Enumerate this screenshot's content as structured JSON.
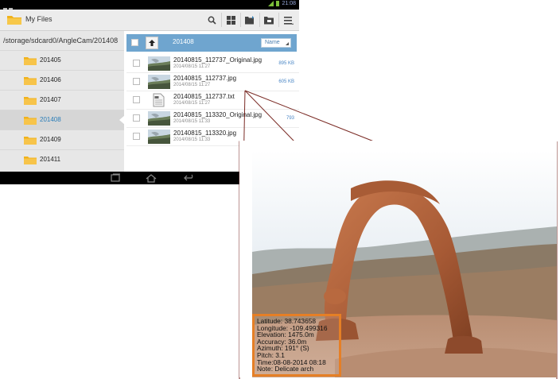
{
  "app": {
    "title": "My Files"
  },
  "actions": [
    "search-icon",
    "grid-view-icon",
    "new-folder-icon",
    "view-mode-icon",
    "more-menu-icon"
  ],
  "path": "/storage/sdcard0/AngleCam/201408",
  "folders": [
    {
      "name": "201405",
      "selected": false
    },
    {
      "name": "201406",
      "selected": false
    },
    {
      "name": "201407",
      "selected": false
    },
    {
      "name": "201408",
      "selected": true
    },
    {
      "name": "201409",
      "selected": false
    },
    {
      "name": "201411",
      "selected": false
    }
  ],
  "list_header": {
    "current_folder": "201408",
    "sort_label": "Name"
  },
  "files": [
    {
      "name": "20140815_112737_Original.jpg",
      "date": "2014/08/15 11:27",
      "size": "895 KB",
      "type": "image"
    },
    {
      "name": "20140815_112737.jpg",
      "date": "2014/08/15 11:27",
      "size": "605 KB",
      "type": "image"
    },
    {
      "name": "20140815_112737.txt",
      "date": "2014/08/15 11:27",
      "size": "",
      "type": "text"
    },
    {
      "name": "20140815_113320_Original.jpg",
      "date": "2014/08/15 11:33",
      "size": "793",
      "type": "image"
    },
    {
      "name": "20140815_113320.jpg",
      "date": "2014/08/15 11:33",
      "size": "",
      "type": "image"
    }
  ],
  "status": {
    "time": "21:08"
  },
  "photo_info": [
    "Latitude: 38.743658",
    "Longitude: -109.499316",
    "Elevation: 1475.0m",
    "Accuracy: 36.0m",
    "Azimuth: 191° (S)",
    "Pitch: 3.1",
    "Time:08-08-2014 08:18",
    "Note: Delicate arch"
  ],
  "colors": {
    "accent": "#6fa5cf",
    "highlight_border": "#e57f26",
    "callout_line": "#7a2a24",
    "link_blue": "#2a7db8"
  }
}
